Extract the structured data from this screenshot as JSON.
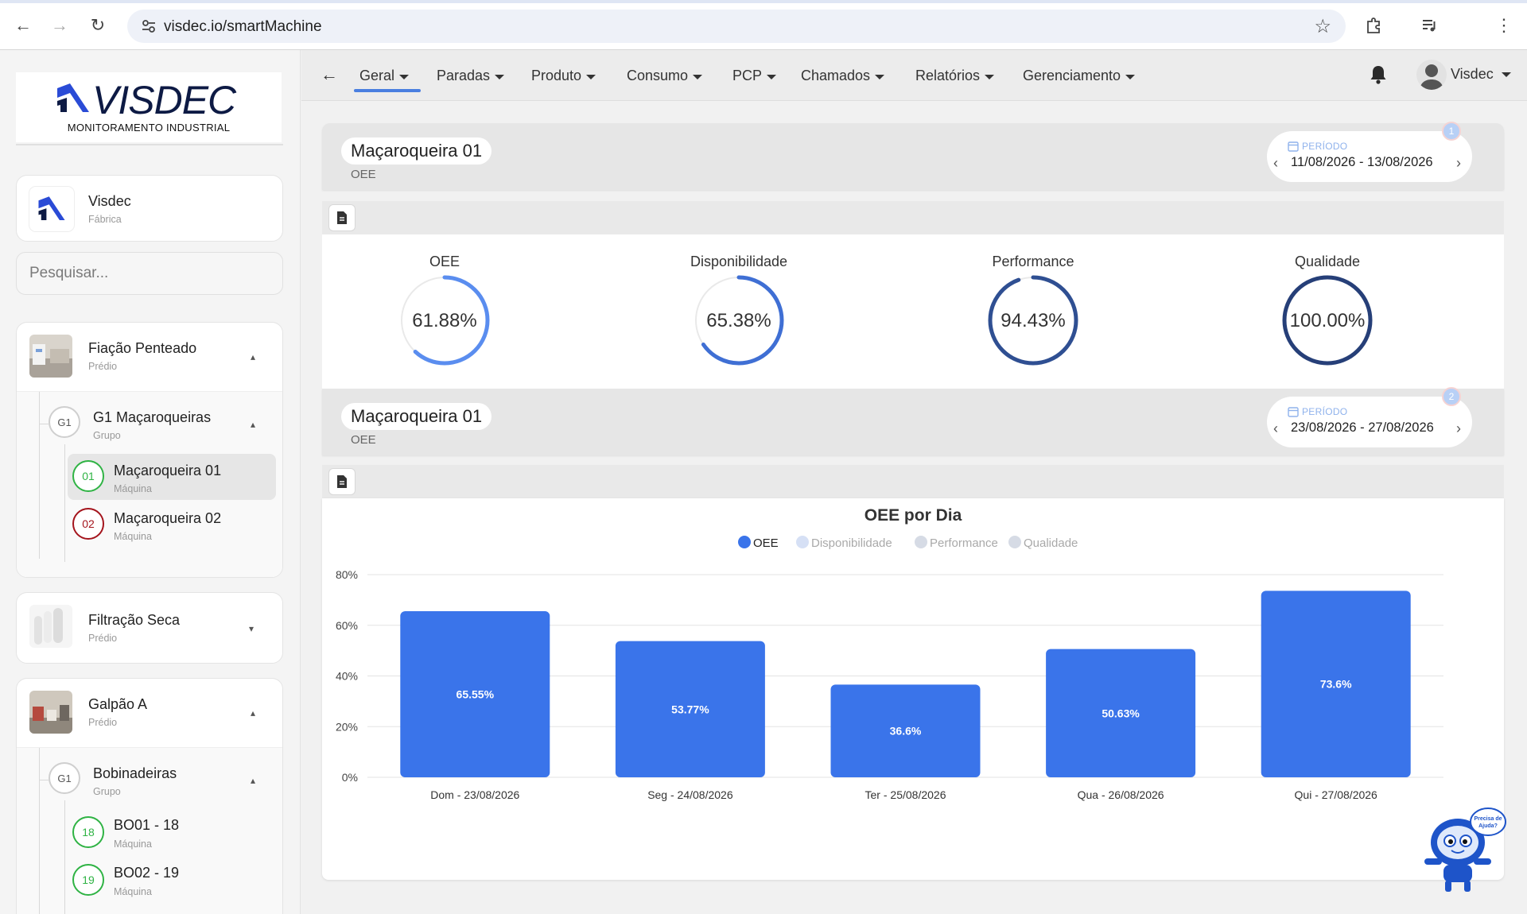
{
  "browser": {
    "url": "visdec.io/smartMachine"
  },
  "sidebar": {
    "brand": "VISDEC",
    "tagline": "MONITORAMENTO INDUSTRIAL",
    "org": {
      "name": "Visdec",
      "type": "Fábrica"
    },
    "search_placeholder": "Pesquisar...",
    "buildings": [
      {
        "name": "Fiação Penteado",
        "type": "Prédio",
        "group": {
          "badge": "G1",
          "name": "G1 Maçaroqueiras",
          "type": "Grupo"
        },
        "machines": [
          {
            "badge": "01",
            "name": "Maçaroqueira 01",
            "type": "Máquina",
            "status": "ok"
          },
          {
            "badge": "02",
            "name": "Maçaroqueira 02",
            "type": "Máquina",
            "status": "bad"
          }
        ]
      },
      {
        "name": "Filtração Seca",
        "type": "Prédio"
      },
      {
        "name": "Galpão A",
        "type": "Prédio",
        "group": {
          "badge": "G1",
          "name": "Bobinadeiras",
          "type": "Grupo"
        },
        "machines": [
          {
            "badge": "18",
            "name": "BO01 - 18",
            "type": "Máquina",
            "status": "ok"
          },
          {
            "badge": "19",
            "name": "BO02 - 19",
            "type": "Máquina",
            "status": "ok"
          }
        ]
      }
    ]
  },
  "nav": {
    "items": [
      "Geral",
      "Paradas",
      "Produto",
      "Consumo",
      "PCP",
      "Chamados",
      "Relatórios",
      "Gerenciamento"
    ],
    "user": "Visdec"
  },
  "panel1": {
    "title": "Maçaroqueira 01",
    "subtitle": "OEE",
    "period_label": "PERÍODO",
    "period": "11/08/2026 - 13/08/2026",
    "badge": "1",
    "gauges": [
      {
        "label": "OEE",
        "value": "61.88%",
        "fraction": 0.6188,
        "color": "#5a8def"
      },
      {
        "label": "Disponibilidade",
        "value": "65.38%",
        "fraction": 0.6538,
        "color": "#3f6fd4"
      },
      {
        "label": "Performance",
        "value": "94.43%",
        "fraction": 0.9443,
        "color": "#2f4f92"
      },
      {
        "label": "Qualidade",
        "value": "100.00%",
        "fraction": 1.0,
        "color": "#263f78"
      }
    ]
  },
  "panel2": {
    "title": "Maçaroqueira 01",
    "subtitle": "OEE",
    "period_label": "PERÍODO",
    "period": "23/08/2026 - 27/08/2026",
    "badge": "2"
  },
  "chart_data": {
    "type": "bar",
    "title": "OEE por Dia",
    "legend": [
      "OEE",
      "Disponibilidade",
      "Performance",
      "Qualidade"
    ],
    "legend_active": "OEE",
    "legend_placement": "top-center",
    "categories": [
      "Dom - 23/08/2026",
      "Seg - 24/08/2026",
      "Ter - 25/08/2026",
      "Qua - 26/08/2026",
      "Qui - 27/08/2026"
    ],
    "series": [
      {
        "name": "OEE",
        "values": [
          65.55,
          53.77,
          36.6,
          50.63,
          73.6
        ],
        "labels": [
          "65.55%",
          "53.77%",
          "36.6%",
          "50.63%",
          "73.6%"
        ]
      }
    ],
    "yticks": [
      "0%",
      "20%",
      "40%",
      "60%",
      "80%"
    ],
    "ylim": [
      0,
      80
    ],
    "grid": true,
    "bar_color": "#3a74ea"
  },
  "help": {
    "text": "Precisa de Ajuda?"
  }
}
